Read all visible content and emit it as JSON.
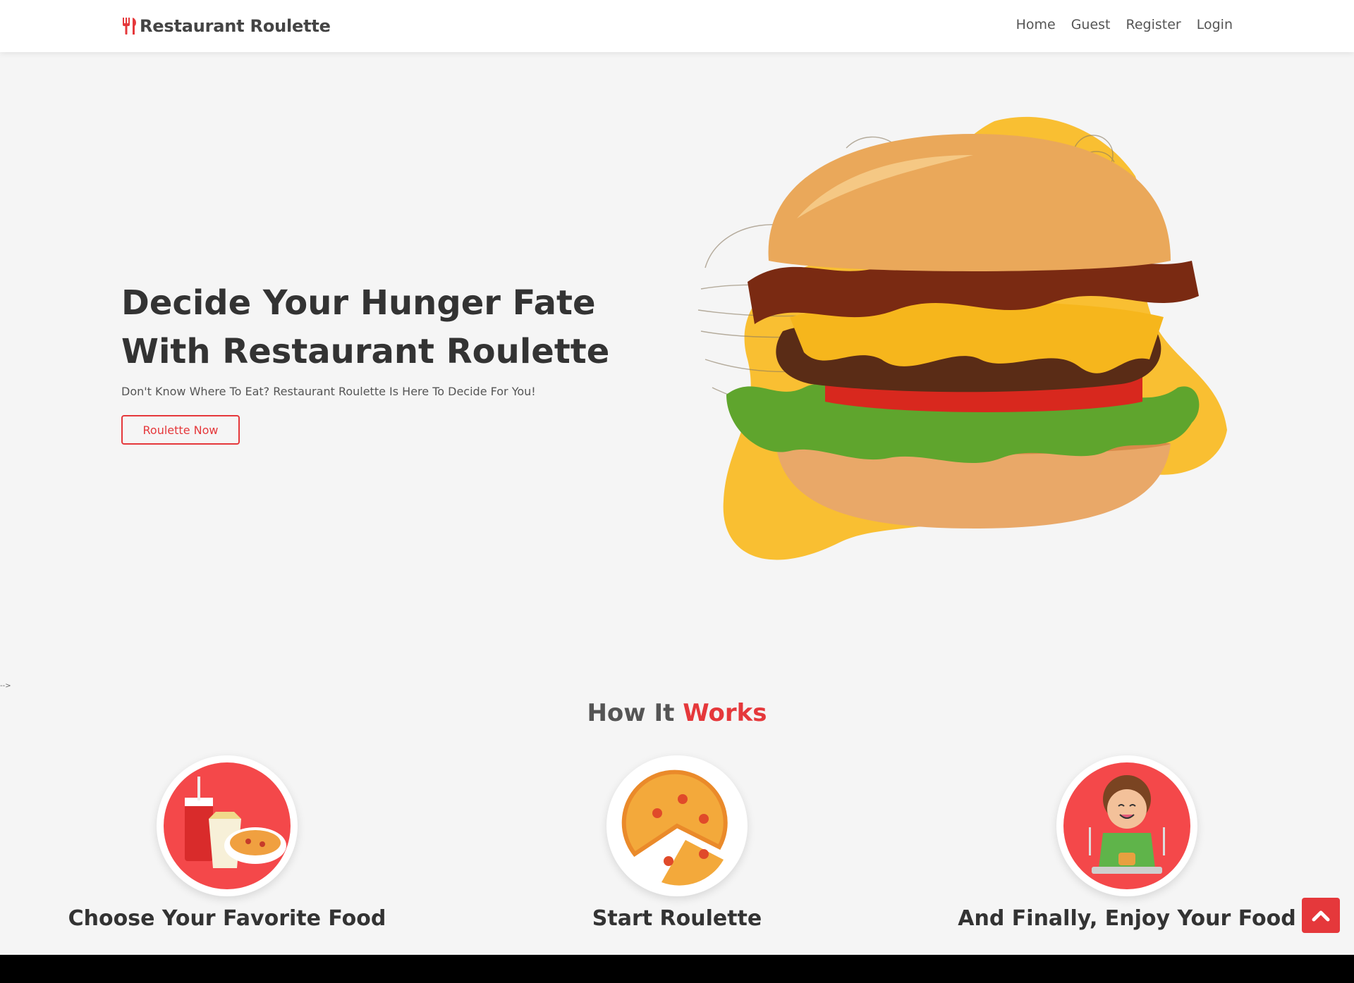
{
  "header": {
    "brand": "Restaurant Roulette",
    "nav": [
      {
        "label": "Home"
      },
      {
        "label": "Guest"
      },
      {
        "label": "Register"
      },
      {
        "label": "Login"
      }
    ]
  },
  "hero": {
    "title": "Decide Your Hunger Fate With Restaurant Roulette",
    "subtitle": "Don't Know Where To Eat? Restaurant Roulette Is Here To Decide For You!",
    "cta_label": "Roulette Now"
  },
  "stray_text": "-->",
  "how": {
    "title_main": "How It",
    "title_accent": "Works",
    "steps": [
      {
        "label": "Choose Your Favorite Food",
        "icon": "fast-food-icon"
      },
      {
        "label": "Start Roulette",
        "icon": "pizza-icon"
      },
      {
        "label": "And Finally, Enjoy Your Food",
        "icon": "happy-eater-icon"
      }
    ]
  },
  "icons": {
    "brand": "utensils-icon",
    "scroll_top": "chevron-up-icon"
  },
  "colors": {
    "accent": "#e5383b",
    "blob": "#f9bf32",
    "text": "#333333"
  }
}
